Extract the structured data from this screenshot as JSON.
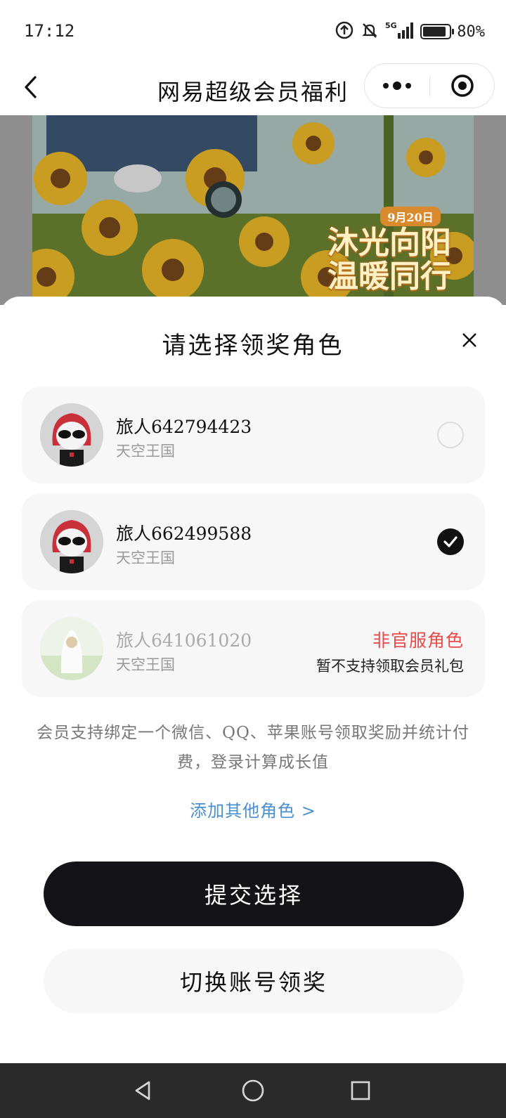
{
  "status_bar": {
    "time": "17:12",
    "network": "5G",
    "battery_percent": "80%",
    "battery_level": 0.8
  },
  "nav": {
    "title": "网易超级会员福利",
    "icons": {
      "back": "back-arrow-icon",
      "more": "more-dots-icon",
      "close": "target-close-icon"
    }
  },
  "banner": {
    "date": "9月20日",
    "line1": "沐光向阳",
    "line2": "温暖同行"
  },
  "dialog": {
    "title": "请选择领奖角色",
    "roles": [
      {
        "name": "旅人642794423",
        "server": "天空王国",
        "selected": false
      },
      {
        "name": "旅人662499588",
        "server": "天空王国",
        "selected": true
      },
      {
        "name": "旅人641061020",
        "server": "天空王国",
        "selected": false,
        "warning_title": "非官服角色",
        "warning_text": "暂不支持领取会员礼包"
      }
    ],
    "notice": "会员支持绑定一个微信、QQ、苹果账号领取奖励并统计付费，登录计算成长值",
    "add_role_link": "添加其他角色 >",
    "submit_label": "提交选择",
    "switch_label": "切换账号领奖"
  },
  "colors": {
    "primary_button": "#141418",
    "warning": "#e84a4a",
    "link": "#4a8fd0"
  }
}
